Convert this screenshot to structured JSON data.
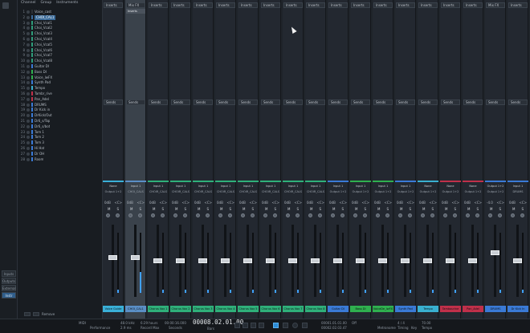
{
  "left_panel": {
    "buttons": [
      "Inputs",
      "Outputs",
      "External",
      "Instr"
    ],
    "selected": "Instr"
  },
  "tracks_header": {
    "tabs": [
      "Channel",
      "Group",
      "Instruments"
    ]
  },
  "tracks": [
    {
      "num": "1",
      "name": "Voice_cast",
      "color": "#2c3036"
    },
    {
      "num": "2",
      "name": "CHOI_CAL1",
      "color": "#3a6a99"
    },
    {
      "num": "3",
      "name": "Choi_Vcal1",
      "color": "#2f9c7a"
    },
    {
      "num": "4",
      "name": "Choi_Vcal2",
      "color": "#2f9c7a"
    },
    {
      "num": "5",
      "name": "Choi_Vcal3",
      "color": "#2f9c7a"
    },
    {
      "num": "6",
      "name": "Choi_Vcal4",
      "color": "#2f9c7a"
    },
    {
      "num": "7",
      "name": "Choi_Vcal5",
      "color": "#2f9c7a"
    },
    {
      "num": "8",
      "name": "Choi_Vcal6",
      "color": "#2f9c7a"
    },
    {
      "num": "9",
      "name": "Choi_Vcal7",
      "color": "#2f9c7a"
    },
    {
      "num": "10",
      "name": "Choi_Vcal8",
      "color": "#2f9c7a"
    },
    {
      "num": "11",
      "name": "Guitar DI",
      "color": "#3a7ad6"
    },
    {
      "num": "12",
      "name": "Bass DI",
      "color": "#2fb04f"
    },
    {
      "num": "13",
      "name": "Voice_lwFX",
      "color": "#2fb04f"
    },
    {
      "num": "14",
      "name": "Synth Pad",
      "color": "#3a7ad6"
    },
    {
      "num": "15",
      "name": "Tempo",
      "color": "#39b0d0"
    },
    {
      "num": "16",
      "name": "Tambr_rive",
      "color": "#c0304a"
    },
    {
      "num": "17",
      "name": "Pan_Adel",
      "color": "#c0304a"
    },
    {
      "num": "18",
      "name": "DRUMS",
      "color": "#3a7ad6"
    },
    {
      "num": "19",
      "name": "Dr Kick in",
      "color": "#3a7ad6"
    },
    {
      "num": "20",
      "name": "DrKick/Out",
      "color": "#3a7ad6"
    },
    {
      "num": "21",
      "name": "Dr6_s/Top",
      "color": "#3a7ad6"
    },
    {
      "num": "22",
      "name": "Dr6_s/bot",
      "color": "#3a7ad6"
    },
    {
      "num": "23",
      "name": "Tom 1",
      "color": "#3a7ad6"
    },
    {
      "num": "24",
      "name": "Tom 2",
      "color": "#3a7ad6"
    },
    {
      "num": "25",
      "name": "Tom 3",
      "color": "#3a7ad6"
    },
    {
      "num": "26",
      "name": "Hi Hat",
      "color": "#3a7ad6"
    },
    {
      "num": "27",
      "name": "Dr OH",
      "color": "#3a7ad6"
    },
    {
      "num": "28",
      "name": "Room",
      "color": "#3a7ad6"
    }
  ],
  "tracks_footer": {
    "remove": "Remove"
  },
  "mixer": {
    "insert_label": "Inserts",
    "sends_label": "Sends",
    "mix_fx_label": "Mix FX",
    "inserts_sub": "Inserts",
    "output_default": "Output 1+2",
    "channels": [
      {
        "insert": "Inserts",
        "in": "None",
        "out": "Output 1+2",
        "label": "Voice Guide",
        "color": "#3ab0d8",
        "vol": "0dB",
        "fader": 0.55,
        "meter": 0.05
      },
      {
        "insert": "Mix FX",
        "in": "Input 1",
        "out": "CHOI_CALS",
        "label": "CHOI_CAL1",
        "color": "#5a8fc6",
        "vol": "0dB",
        "fader": 0.55,
        "meter": 0.35
      },
      {
        "insert": "Inserts",
        "in": "Input 1",
        "out": "CHOIR_CALS",
        "label": "Chorus Vox 1",
        "color": "#2fb07a",
        "vol": "0dB",
        "fader": 0.5,
        "meter": 0.05
      },
      {
        "insert": "Inserts",
        "in": "Input 1",
        "out": "CHOIR_CALS",
        "label": "Chorus Vox 2",
        "color": "#2fb07a",
        "vol": "0dB",
        "fader": 0.5,
        "meter": 0.05
      },
      {
        "insert": "Inserts",
        "in": "Input 1",
        "out": "CHOIR_CALS",
        "label": "Chorus Vox 3",
        "color": "#2fb07a",
        "vol": "0dB",
        "fader": 0.5,
        "meter": 0.05
      },
      {
        "insert": "Inserts",
        "in": "Input 1",
        "out": "CHOIR_CALS",
        "label": "Chorus Vox 4",
        "color": "#2fb07a",
        "vol": "0dB",
        "fader": 0.5,
        "meter": 0.05
      },
      {
        "insert": "Inserts",
        "in": "Input 1",
        "out": "CHOIR_CALS",
        "label": "Chorus Vox 5",
        "color": "#2fb07a",
        "vol": "0dB",
        "fader": 0.5,
        "meter": 0.05
      },
      {
        "insert": "Inserts",
        "in": "Input 1",
        "out": "CHOIR_CALS",
        "label": "Chorus Vox 6",
        "color": "#2fb07a",
        "vol": "0dB",
        "fader": 0.5,
        "meter": 0.05
      },
      {
        "insert": "Inserts",
        "in": "Input 1",
        "out": "CHOIR_CALS",
        "label": "Chorus Vox 7",
        "color": "#2fb07a",
        "vol": "0dB",
        "fader": 0.5,
        "meter": 0.05
      },
      {
        "insert": "Inserts",
        "in": "Input 1",
        "out": "CHOIR_CALS",
        "label": "Chorus Vox 8",
        "color": "#2fb07a",
        "vol": "0dB",
        "fader": 0.5,
        "meter": 0.05
      },
      {
        "insert": "Inserts",
        "in": "Input 1",
        "out": "Output 1+2",
        "label": "Guitar DI",
        "color": "#3a7ad6",
        "vol": "0dB",
        "fader": 0.5,
        "meter": 0.05
      },
      {
        "insert": "Inserts",
        "in": "Input 1",
        "out": "Output 1+2",
        "label": "Bass DI",
        "color": "#2fb04f",
        "vol": "0dB",
        "fader": 0.5,
        "meter": 0.05
      },
      {
        "insert": "Inserts",
        "in": "Input 1",
        "out": "Output 1+2",
        "label": "VoiceDe_lwFX",
        "color": "#2fb04f",
        "vol": "0dB",
        "fader": 0.5,
        "meter": 0.05
      },
      {
        "insert": "Inserts",
        "in": "Input 1",
        "out": "Output 1+2",
        "label": "Synth Pad",
        "color": "#3a7ad6",
        "vol": "0dB",
        "fader": 0.5,
        "meter": 0.05
      },
      {
        "insert": "Inserts",
        "in": "None",
        "out": "Output 1+2",
        "label": "Tempo",
        "color": "#39b0d0",
        "vol": "0dB",
        "fader": 0.5,
        "meter": 0.05
      },
      {
        "insert": "Inserts",
        "in": "None",
        "out": "Output 1+2",
        "label": "Tambourine",
        "color": "#c0304a",
        "vol": "0dB",
        "fader": 0.5,
        "meter": 0.05
      },
      {
        "insert": "Inserts",
        "in": "None",
        "out": "Output 1+2",
        "label": "Pan_Adel",
        "color": "#c0304a",
        "vol": "0dB",
        "fader": 0.5,
        "meter": 0.05
      },
      {
        "insert": "Mix FX",
        "in": "Output 1+2",
        "out": "Output 1+2",
        "label": "DRUMS",
        "color": "#3a7ad6",
        "vol": "-4.0",
        "fader": 0.62,
        "meter": 0.05
      },
      {
        "insert": "Inserts",
        "in": "Input 1",
        "out": "DRUMS",
        "label": "Dr Kick In",
        "color": "#3a7ad6",
        "vol": "0dB",
        "fader": 0.5,
        "meter": 0.05
      }
    ]
  },
  "transport": {
    "midi": "MIDI",
    "performance": "Performance",
    "sample_rate": "48.0 kHz",
    "latency": "2.9 ms",
    "record_time": "6:29 hours",
    "record_max": "Record Max",
    "seconds": "00:00:16.000",
    "seconds_label": "Seconds",
    "bars": "00008.02.01.00",
    "bars_label": "Bars",
    "loop_start": "00001.01.01.00",
    "loop_end": "00002.02.03.47",
    "sync": "Off",
    "metronome": "Metronome",
    "timesig": "4 / 4",
    "timing": "Timing",
    "key": "Key",
    "tempo": "70.00",
    "tempo_label": "Tempo"
  }
}
